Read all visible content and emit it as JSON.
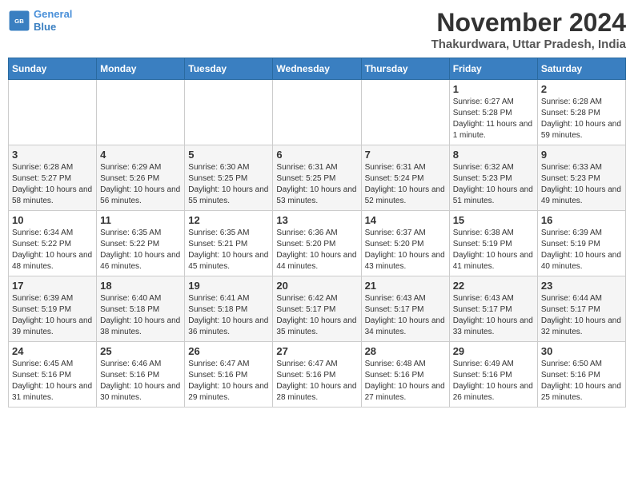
{
  "header": {
    "logo_line1": "General",
    "logo_line2": "Blue",
    "title": "November 2024",
    "subtitle": "Thakurdwara, Uttar Pradesh, India"
  },
  "days_of_week": [
    "Sunday",
    "Monday",
    "Tuesday",
    "Wednesday",
    "Thursday",
    "Friday",
    "Saturday"
  ],
  "weeks": [
    {
      "days": [
        {
          "number": "",
          "info": ""
        },
        {
          "number": "",
          "info": ""
        },
        {
          "number": "",
          "info": ""
        },
        {
          "number": "",
          "info": ""
        },
        {
          "number": "",
          "info": ""
        },
        {
          "number": "1",
          "info": "Sunrise: 6:27 AM\nSunset: 5:28 PM\nDaylight: 11 hours and 1 minute."
        },
        {
          "number": "2",
          "info": "Sunrise: 6:28 AM\nSunset: 5:28 PM\nDaylight: 10 hours and 59 minutes."
        }
      ]
    },
    {
      "days": [
        {
          "number": "3",
          "info": "Sunrise: 6:28 AM\nSunset: 5:27 PM\nDaylight: 10 hours and 58 minutes."
        },
        {
          "number": "4",
          "info": "Sunrise: 6:29 AM\nSunset: 5:26 PM\nDaylight: 10 hours and 56 minutes."
        },
        {
          "number": "5",
          "info": "Sunrise: 6:30 AM\nSunset: 5:25 PM\nDaylight: 10 hours and 55 minutes."
        },
        {
          "number": "6",
          "info": "Sunrise: 6:31 AM\nSunset: 5:25 PM\nDaylight: 10 hours and 53 minutes."
        },
        {
          "number": "7",
          "info": "Sunrise: 6:31 AM\nSunset: 5:24 PM\nDaylight: 10 hours and 52 minutes."
        },
        {
          "number": "8",
          "info": "Sunrise: 6:32 AM\nSunset: 5:23 PM\nDaylight: 10 hours and 51 minutes."
        },
        {
          "number": "9",
          "info": "Sunrise: 6:33 AM\nSunset: 5:23 PM\nDaylight: 10 hours and 49 minutes."
        }
      ]
    },
    {
      "days": [
        {
          "number": "10",
          "info": "Sunrise: 6:34 AM\nSunset: 5:22 PM\nDaylight: 10 hours and 48 minutes."
        },
        {
          "number": "11",
          "info": "Sunrise: 6:35 AM\nSunset: 5:22 PM\nDaylight: 10 hours and 46 minutes."
        },
        {
          "number": "12",
          "info": "Sunrise: 6:35 AM\nSunset: 5:21 PM\nDaylight: 10 hours and 45 minutes."
        },
        {
          "number": "13",
          "info": "Sunrise: 6:36 AM\nSunset: 5:20 PM\nDaylight: 10 hours and 44 minutes."
        },
        {
          "number": "14",
          "info": "Sunrise: 6:37 AM\nSunset: 5:20 PM\nDaylight: 10 hours and 43 minutes."
        },
        {
          "number": "15",
          "info": "Sunrise: 6:38 AM\nSunset: 5:19 PM\nDaylight: 10 hours and 41 minutes."
        },
        {
          "number": "16",
          "info": "Sunrise: 6:39 AM\nSunset: 5:19 PM\nDaylight: 10 hours and 40 minutes."
        }
      ]
    },
    {
      "days": [
        {
          "number": "17",
          "info": "Sunrise: 6:39 AM\nSunset: 5:19 PM\nDaylight: 10 hours and 39 minutes."
        },
        {
          "number": "18",
          "info": "Sunrise: 6:40 AM\nSunset: 5:18 PM\nDaylight: 10 hours and 38 minutes."
        },
        {
          "number": "19",
          "info": "Sunrise: 6:41 AM\nSunset: 5:18 PM\nDaylight: 10 hours and 36 minutes."
        },
        {
          "number": "20",
          "info": "Sunrise: 6:42 AM\nSunset: 5:17 PM\nDaylight: 10 hours and 35 minutes."
        },
        {
          "number": "21",
          "info": "Sunrise: 6:43 AM\nSunset: 5:17 PM\nDaylight: 10 hours and 34 minutes."
        },
        {
          "number": "22",
          "info": "Sunrise: 6:43 AM\nSunset: 5:17 PM\nDaylight: 10 hours and 33 minutes."
        },
        {
          "number": "23",
          "info": "Sunrise: 6:44 AM\nSunset: 5:17 PM\nDaylight: 10 hours and 32 minutes."
        }
      ]
    },
    {
      "days": [
        {
          "number": "24",
          "info": "Sunrise: 6:45 AM\nSunset: 5:16 PM\nDaylight: 10 hours and 31 minutes."
        },
        {
          "number": "25",
          "info": "Sunrise: 6:46 AM\nSunset: 5:16 PM\nDaylight: 10 hours and 30 minutes."
        },
        {
          "number": "26",
          "info": "Sunrise: 6:47 AM\nSunset: 5:16 PM\nDaylight: 10 hours and 29 minutes."
        },
        {
          "number": "27",
          "info": "Sunrise: 6:47 AM\nSunset: 5:16 PM\nDaylight: 10 hours and 28 minutes."
        },
        {
          "number": "28",
          "info": "Sunrise: 6:48 AM\nSunset: 5:16 PM\nDaylight: 10 hours and 27 minutes."
        },
        {
          "number": "29",
          "info": "Sunrise: 6:49 AM\nSunset: 5:16 PM\nDaylight: 10 hours and 26 minutes."
        },
        {
          "number": "30",
          "info": "Sunrise: 6:50 AM\nSunset: 5:16 PM\nDaylight: 10 hours and 25 minutes."
        }
      ]
    }
  ]
}
